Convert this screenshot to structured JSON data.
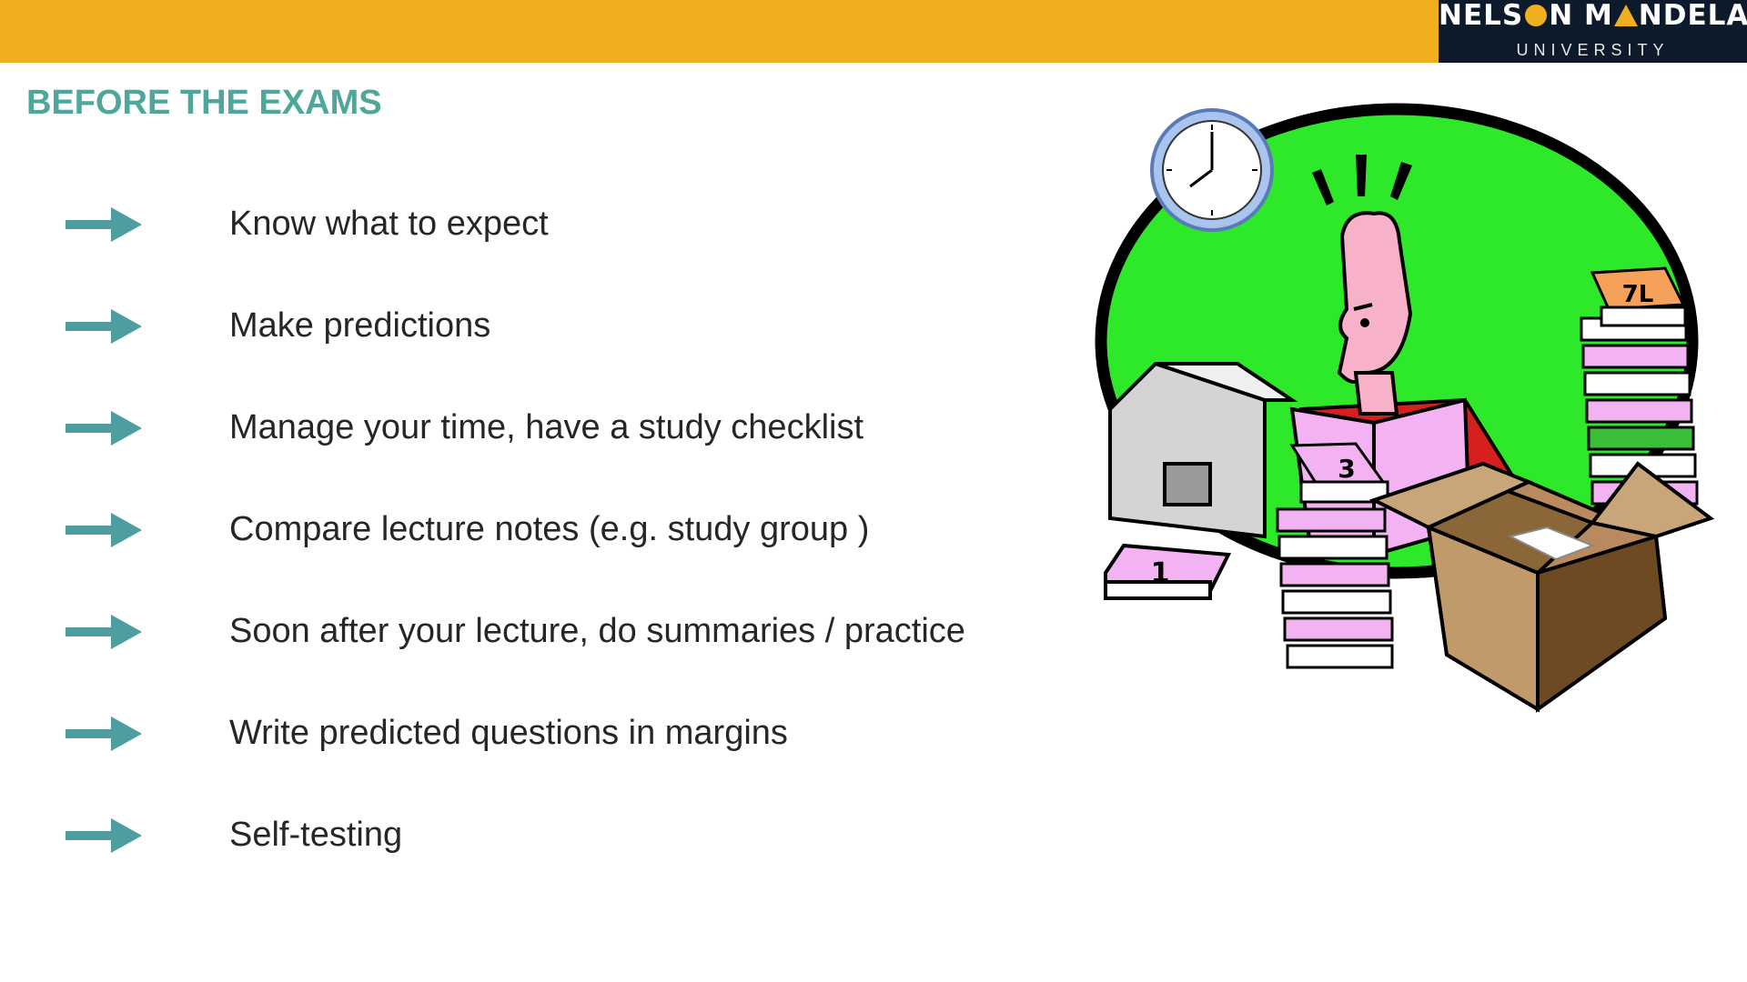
{
  "header": {
    "bar_color": "#efaf1f",
    "logo": {
      "name_part1": "NELS",
      "name_part2": "N M",
      "name_part3": "NDELA",
      "subtitle": "UNIVERSITY"
    }
  },
  "slide": {
    "title": "BEFORE THE EXAMS",
    "bullets": [
      "Know what to expect",
      "Make predictions",
      "Manage your time, have a study checklist",
      "Compare lecture notes  (e.g. study group )",
      "Soon after your lecture, do summaries / practice",
      "Write predicted questions in margins",
      "Self-testing"
    ],
    "accent_color": "#4da79a",
    "illustration": "stressed-student-studying-clipart"
  },
  "clipart_labels": {
    "book_top": "7L",
    "book_mid": "3",
    "book_low": "1"
  }
}
